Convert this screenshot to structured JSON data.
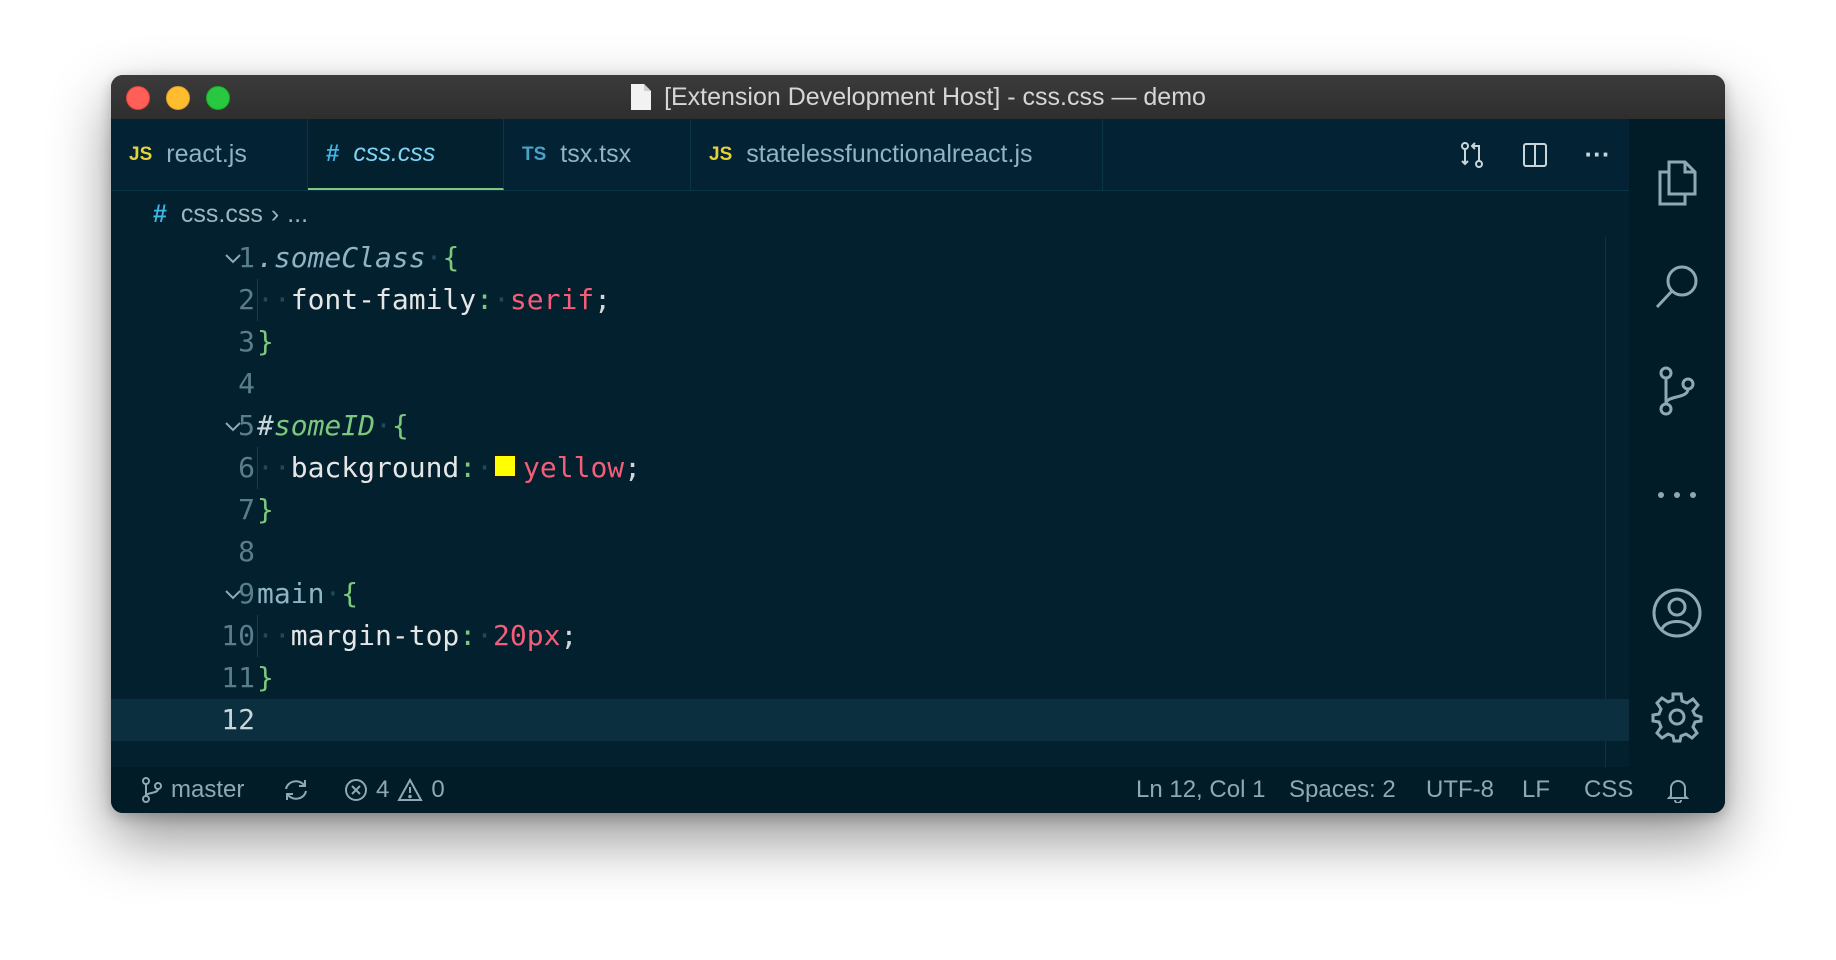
{
  "window": {
    "title": "[Extension Development Host] - css.css — demo"
  },
  "tabs": [
    {
      "icon_text": "JS",
      "label": "react.js",
      "active": false
    },
    {
      "icon_text": "#",
      "label": "css.css",
      "active": true
    },
    {
      "icon_text": "TS",
      "label": "tsx.tsx",
      "active": false
    },
    {
      "icon_text": "JS",
      "label": "statelessfunctionalreact.js",
      "active": false
    }
  ],
  "tab_actions": {
    "compare_icon": "compare-changes-icon",
    "split_icon": "split-editor-icon",
    "more_label": "···"
  },
  "breadcrumb": {
    "icon_text": "#",
    "file": "css.css",
    "separator": "›",
    "rest": "..."
  },
  "editor": {
    "line_numbers": [
      "1",
      "2",
      "3",
      "4",
      "5",
      "6",
      "7",
      "8",
      "9",
      "10",
      "11",
      "12"
    ],
    "current_line": "12",
    "tokens": {
      "l1_selector": ".someClass",
      "l1_brace": "{",
      "l2_prop": "font-family",
      "l2_colon": ":",
      "l2_value": "serif",
      "l2_semi": ";",
      "l3_brace": "}",
      "l5_hash": "#",
      "l5_selector": "someID",
      "l5_brace": "{",
      "l6_prop": "background",
      "l6_colon": ":",
      "l6_value": "yellow",
      "l6_semi": ";",
      "l6_swatch_color": "#ffff00",
      "l7_brace": "}",
      "l9_selector": "main",
      "l9_brace": "{",
      "l10_prop": "margin-top",
      "l10_colon": ":",
      "l10_value": "20px",
      "l10_semi": ";",
      "l11_brace": "}"
    }
  },
  "activity_bar": [
    "files-icon",
    "search-icon",
    "source-control-icon",
    "more-icon",
    "account-icon",
    "settings-gear-icon"
  ],
  "status_bar": {
    "branch": "master",
    "errors": "4",
    "warnings": "0",
    "cursor": "Ln 12, Col 1",
    "indent": "Spaces: 2",
    "encoding": "UTF-8",
    "eol": "LF",
    "language": "CSS"
  },
  "colors": {
    "editor_bg": "#02202e",
    "accent_green": "#7ec87e",
    "value_red": "#f45d78",
    "js_yellow": "#e4d23d",
    "css_blue": "#3fb6e6"
  }
}
